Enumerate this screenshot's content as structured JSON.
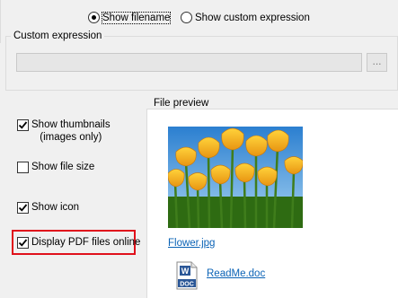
{
  "filename_mode": {
    "option_filename": "Show filename",
    "option_custom": "Show custom expression",
    "selected": "filename"
  },
  "custom_expression": {
    "title": "Custom expression",
    "value": "",
    "browse_label": "..."
  },
  "options": {
    "show_thumbnails": {
      "label_line1": "Show thumbnails",
      "label_line2": "(images only)",
      "checked": true
    },
    "show_file_size": {
      "label": "Show file size",
      "checked": false
    },
    "show_icon": {
      "label": "Show icon",
      "checked": true
    },
    "display_pdf_online": {
      "label": "Display PDF files online",
      "checked": true
    }
  },
  "preview": {
    "title": "File preview",
    "image_file": "Flower.jpg",
    "doc_file": "ReadMe.doc",
    "doc_icon_text": "DOC"
  },
  "colors": {
    "highlight": "#e0101b",
    "link": "#0b63b6",
    "word_blue": "#2b5797"
  }
}
